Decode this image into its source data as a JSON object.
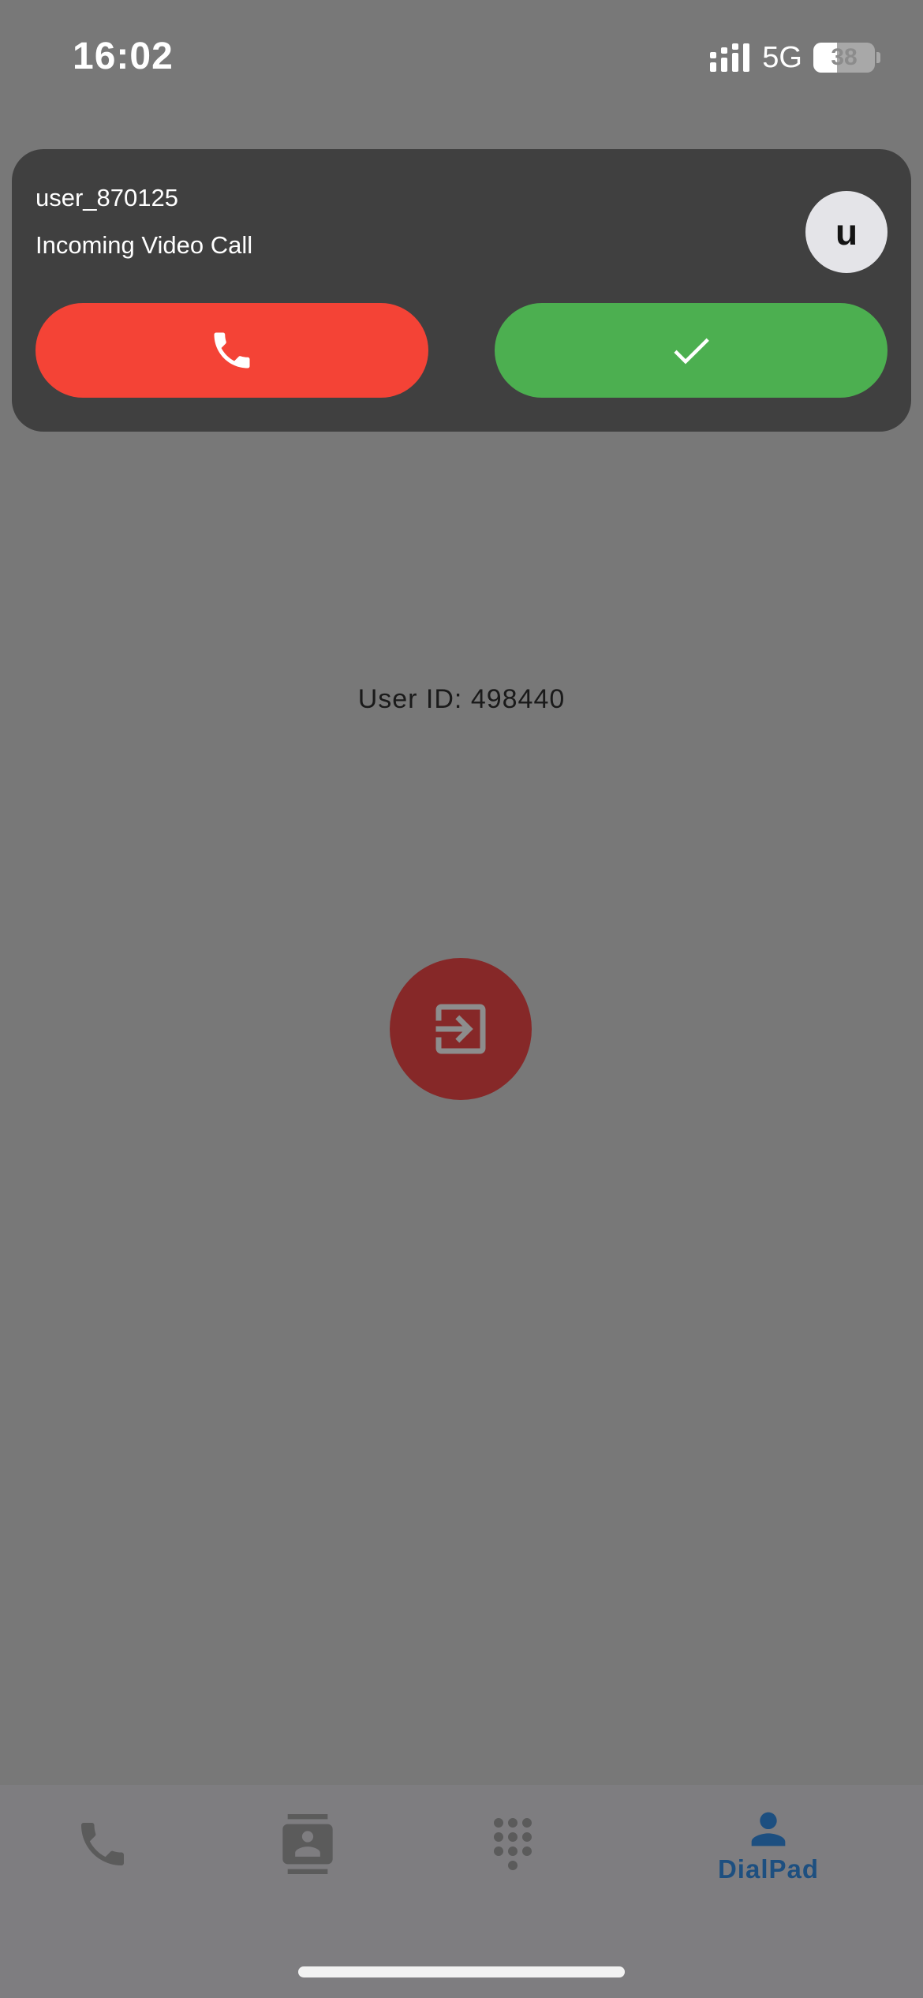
{
  "status_bar": {
    "time": "16:02",
    "network": "5G",
    "battery_level": "38",
    "battery_fraction": 0.38
  },
  "incoming_call": {
    "caller_name": "user_870125",
    "call_type": "Incoming Video Call",
    "avatar_initial": "u",
    "decline_icon": "phone-icon",
    "accept_icon": "checkmark-icon",
    "colors": {
      "card": "#404040",
      "decline": "#f44336",
      "accept": "#4caf50"
    }
  },
  "main": {
    "user_id_text": "User ID: 498440",
    "logout_icon": "exit-to-app-icon",
    "logout_color": "#862828"
  },
  "bottom_nav": {
    "items": [
      {
        "icon": "phone-icon",
        "label": ""
      },
      {
        "icon": "contacts-icon",
        "label": ""
      },
      {
        "icon": "dialpad-icon",
        "label": ""
      },
      {
        "icon": "person-icon",
        "label": "DialPad",
        "active": true
      }
    ],
    "active_color": "#1d4f80",
    "inactive_color": "#5b5b5b"
  }
}
